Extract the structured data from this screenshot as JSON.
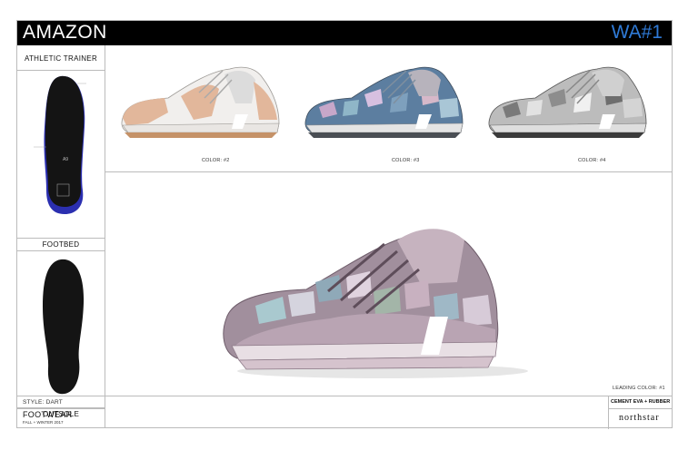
{
  "header": {
    "brand": "AMAZON",
    "code": "WA#1"
  },
  "left": {
    "title": "ATHLETIC TRAINER",
    "footbed_label": "FOOTBED",
    "outsole_label": "OUTSOLE",
    "style": "STYLE: DART",
    "category": "FOOTWEAR",
    "season": "FALL + WINTER 2017",
    "insole_logo": "A9"
  },
  "colorways": [
    {
      "label": "COLOR: #2"
    },
    {
      "label": "COLOR: #3"
    },
    {
      "label": "COLOR: #4"
    }
  ],
  "main": {
    "leading_color": "LEADING COLOR: #1",
    "material": "CEMENT EVA + RUBBER",
    "maker": "northstar"
  },
  "colors": {
    "accent": "#2f7ad6",
    "insole_blue": "#2b2fb0",
    "sole_black": "#141414"
  }
}
